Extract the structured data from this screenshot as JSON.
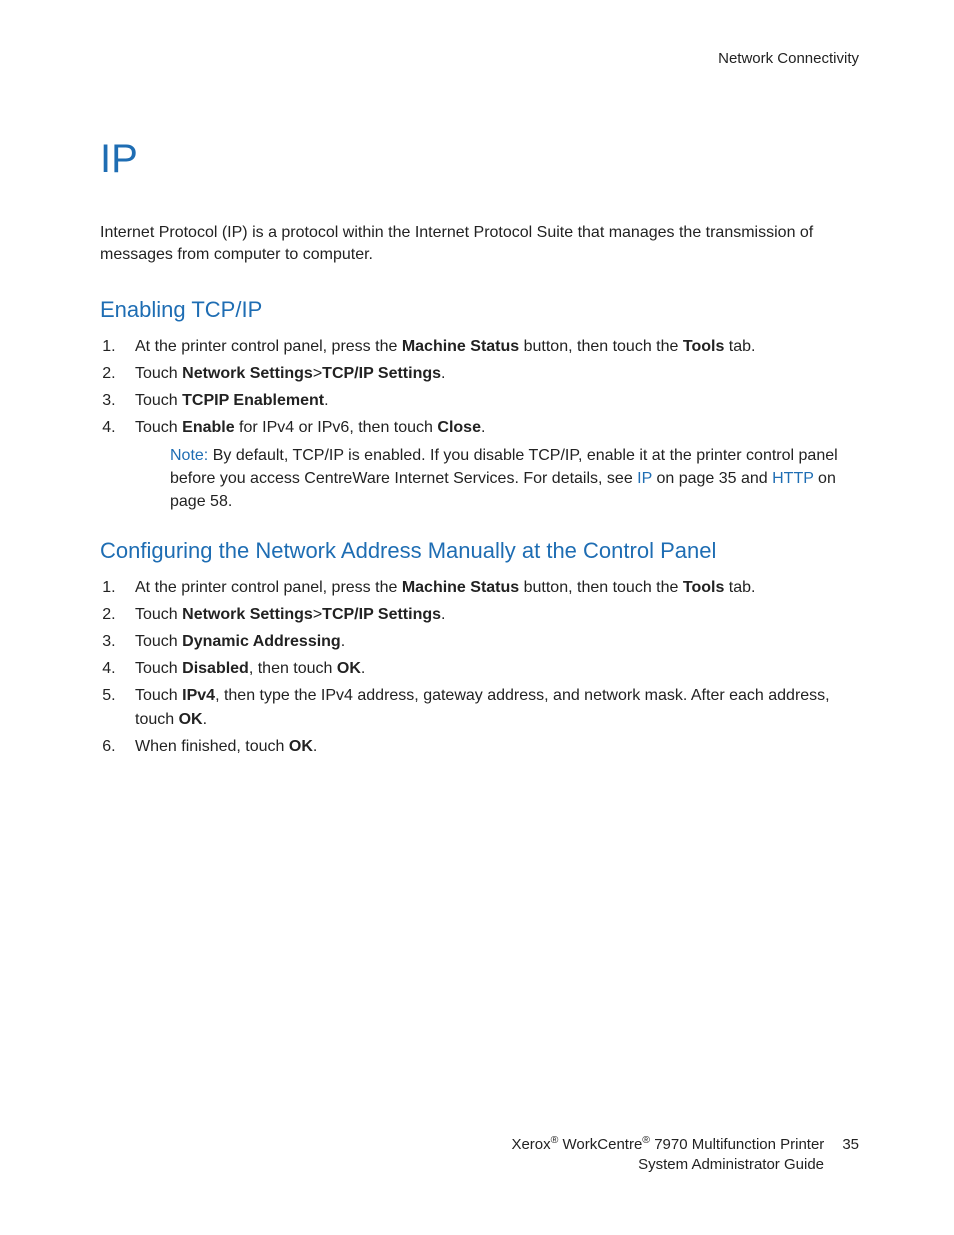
{
  "header": {
    "section": "Network Connectivity"
  },
  "title": "IP",
  "intro": "Internet Protocol (IP) is a protocol within the Internet Protocol Suite that manages the transmission of messages from computer to computer.",
  "section1": {
    "heading": "Enabling TCP/IP",
    "s1_pre": "At the printer control panel, press the ",
    "s1_b1": "Machine Status",
    "s1_mid": " button, then touch the ",
    "s1_b2": "Tools",
    "s1_post": " tab.",
    "s2_pre": "Touch ",
    "s2_b1": "Network Settings",
    "s2_sep": ">",
    "s2_b2": "TCP/IP Settings",
    "s2_post": ".",
    "s3_pre": "Touch ",
    "s3_b1": "TCPIP Enablement",
    "s3_post": ".",
    "s4_pre": "Touch ",
    "s4_b1": "Enable",
    "s4_mid": " for IPv4 or IPv6, then touch ",
    "s4_b2": "Close",
    "s4_post": ".",
    "note_label": "Note:",
    "note_a": " By default, TCP/IP is enabled. If you disable TCP/IP, enable it at the printer control panel before you access CentreWare Internet Services. For details, see ",
    "note_link1": "IP",
    "note_b": " on page 35 and ",
    "note_link2": "HTTP",
    "note_c": " on page 58."
  },
  "section2": {
    "heading": "Configuring the Network Address Manually at the Control Panel",
    "s1_pre": "At the printer control panel, press the ",
    "s1_b1": "Machine Status",
    "s1_mid": " button, then touch the ",
    "s1_b2": "Tools",
    "s1_post": " tab.",
    "s2_pre": "Touch ",
    "s2_b1": "Network Settings",
    "s2_sep": ">",
    "s2_b2": "TCP/IP Settings",
    "s2_post": ".",
    "s3_pre": "Touch ",
    "s3_b1": "Dynamic Addressing",
    "s3_post": ".",
    "s4_pre": "Touch ",
    "s4_b1": "Disabled",
    "s4_mid": ", then touch ",
    "s4_b2": "OK",
    "s4_post": ".",
    "s5_pre": "Touch ",
    "s5_b1": "IPv4",
    "s5_mid": ", then type the IPv4 address, gateway address, and network mask. After each address, touch ",
    "s5_b2": "OK",
    "s5_post": ".",
    "s6_pre": "When finished, touch ",
    "s6_b1": "OK",
    "s6_post": "."
  },
  "footer": {
    "brand_a": "Xerox",
    "brand_b": " WorkCentre",
    "brand_c": " 7970 Multifunction Printer",
    "line2": "System Administrator Guide",
    "page": "35"
  }
}
